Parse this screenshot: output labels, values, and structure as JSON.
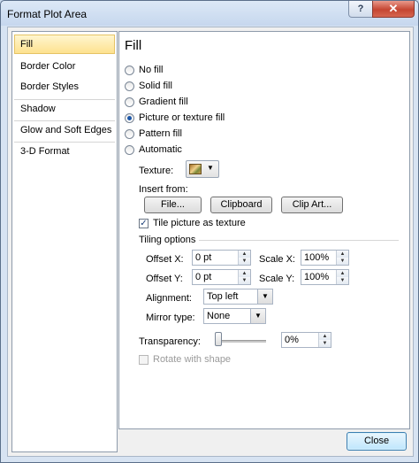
{
  "window": {
    "title": "Format Plot Area",
    "help_label": "?",
    "close_glyph": "✕"
  },
  "nav": {
    "items": [
      {
        "label": "Fill"
      },
      {
        "label": "Border Color"
      },
      {
        "label": "Border Styles"
      },
      {
        "label": "Shadow"
      },
      {
        "label": "Glow and Soft Edges"
      },
      {
        "label": "3-D Format"
      }
    ]
  },
  "fill": {
    "heading": "Fill",
    "options": [
      {
        "label": "No fill"
      },
      {
        "label": "Solid fill"
      },
      {
        "label": "Gradient fill"
      },
      {
        "label": "Picture or texture fill"
      },
      {
        "label": "Pattern fill"
      },
      {
        "label": "Automatic"
      }
    ],
    "texture_label": "Texture:",
    "insert_from_label": "Insert from:",
    "file_button": "File...",
    "clipboard_button": "Clipboard",
    "clipart_button": "Clip Art...",
    "tile_label": "Tile picture as texture",
    "tiling_options_label": "Tiling options",
    "offset_x_label": "Offset X:",
    "offset_x_value": "0 pt",
    "offset_y_label": "Offset Y:",
    "offset_y_value": "0 pt",
    "scale_x_label": "Scale X:",
    "scale_x_value": "100%",
    "scale_y_label": "Scale Y:",
    "scale_y_value": "100%",
    "alignment_label": "Alignment:",
    "alignment_value": "Top left",
    "mirror_label": "Mirror type:",
    "mirror_value": "None",
    "transparency_label": "Transparency:",
    "transparency_value": "0%",
    "rotate_label": "Rotate with shape"
  },
  "footer": {
    "close_button": "Close"
  },
  "colors": {
    "selected_nav": "#fde28f",
    "radio_dot": "#1b56a8",
    "close_red": "#c54632"
  },
  "icons": [
    "help-icon",
    "close-icon",
    "texture-swatch-icon",
    "chevron-down-icon",
    "spin-up-icon",
    "spin-down-icon",
    "checkmark-icon"
  ]
}
